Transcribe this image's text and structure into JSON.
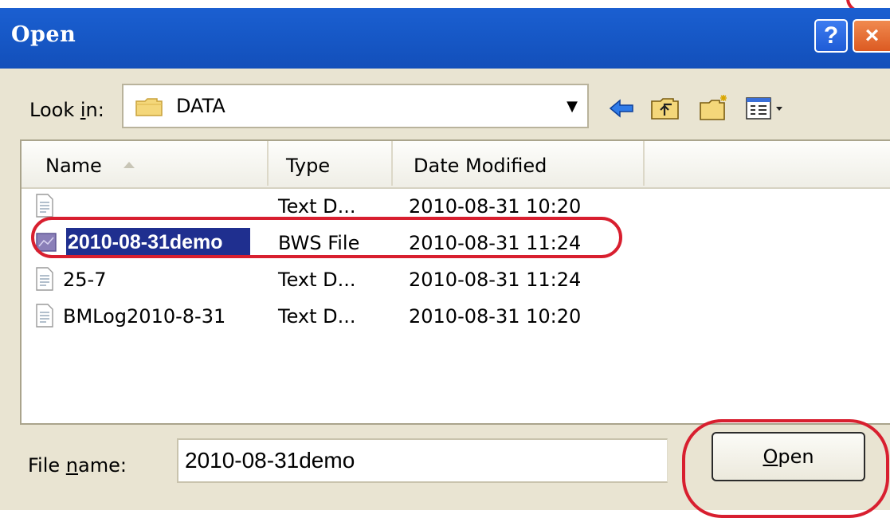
{
  "window": {
    "title": "Open",
    "help_label": "?",
    "close_label": "×"
  },
  "lookin": {
    "label_pre": "Look ",
    "label_accel": "i",
    "label_post": "n:",
    "value": "DATA",
    "folder_icon": "folder-icon",
    "dropdown_glyph": "▼"
  },
  "toolbar": {
    "icons": [
      "back-arrow-icon",
      "up-one-level-icon",
      "new-folder-icon",
      "view-menu-icon"
    ]
  },
  "list": {
    "columns": {
      "name": "Name",
      "type": "Type",
      "date": "Date Modified"
    },
    "sorted_column": "name",
    "rows": [
      {
        "name": "",
        "type": "Text D...",
        "date": "2010-08-31 10:20",
        "icon": "text-file-icon",
        "selected": false
      },
      {
        "name": "2010-08-31demo",
        "type": "BWS File",
        "date": "2010-08-31 11:24",
        "icon": "bws-file-icon",
        "selected": true
      },
      {
        "name": "25-7",
        "type": "Text D...",
        "date": "2010-08-31 11:24",
        "icon": "text-file-icon",
        "selected": false
      },
      {
        "name": "BMLog2010-8-31",
        "type": "Text D...",
        "date": "2010-08-31 10:20",
        "icon": "text-file-icon",
        "selected": false
      }
    ]
  },
  "filename": {
    "label_pre": "File ",
    "label_accel": "n",
    "label_post": "ame:",
    "value": "2010-08-31demo"
  },
  "open_button": {
    "accel": "O",
    "rest": "pen"
  },
  "colors": {
    "titlebar": "#1759c8",
    "dialog_bg": "#e9e4d2",
    "selection": "#1f2f8f",
    "highlight_annotation": "#d81f2f"
  }
}
